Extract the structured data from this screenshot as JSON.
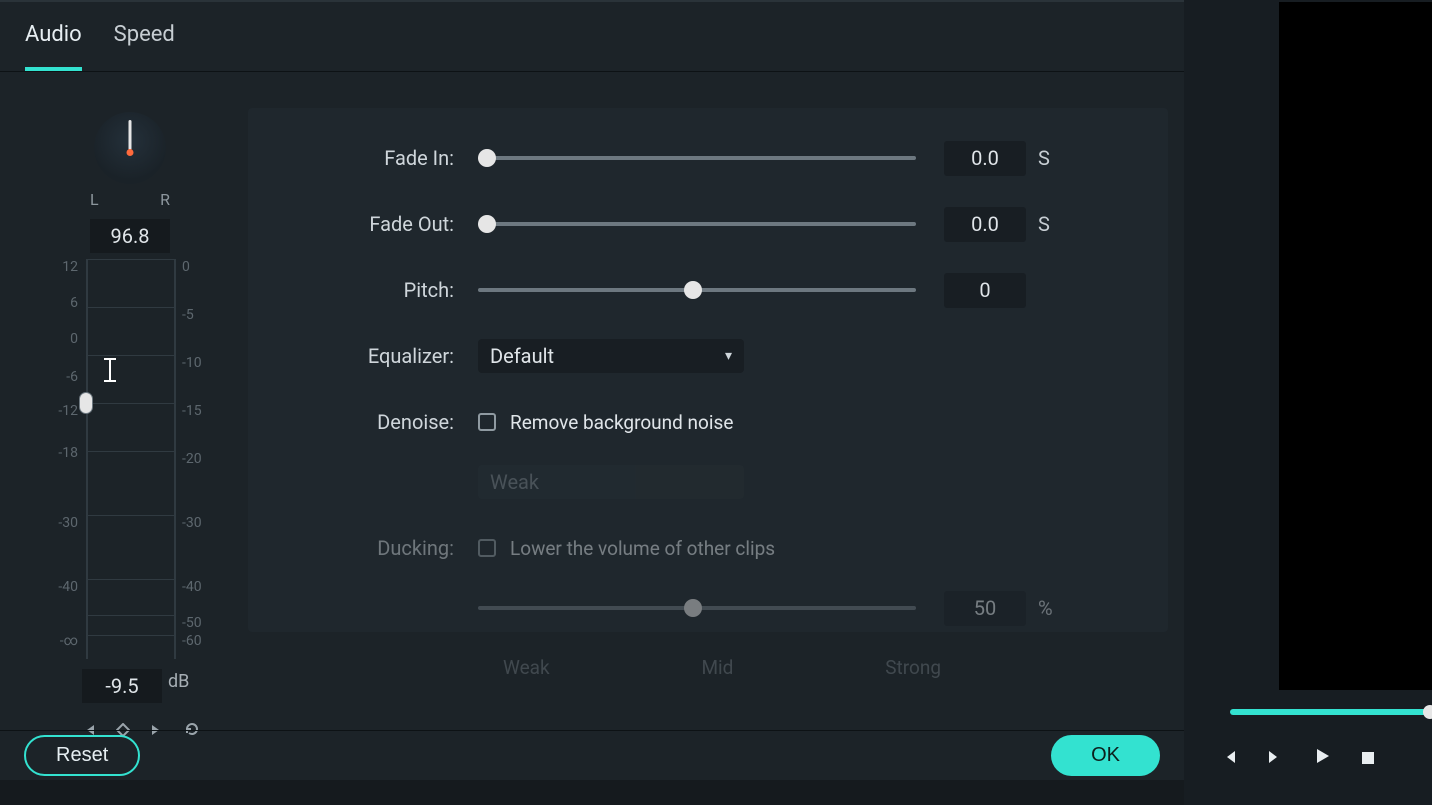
{
  "tabs": {
    "active": "Audio",
    "other": "Speed"
  },
  "pan": {
    "l": "L",
    "r": "R",
    "value": "96.8"
  },
  "db": {
    "left_ticks": [
      "12",
      "6",
      "0",
      "-6",
      "-12",
      "-18",
      "-30",
      "-40",
      "-∞"
    ],
    "right_ticks": [
      "0",
      "-5",
      "-10",
      "-15",
      "-20",
      "-30",
      "-40",
      "-50",
      "-60"
    ],
    "value": "-9.5",
    "unit": "dB"
  },
  "fade_in": {
    "label": "Fade In:",
    "value": "0.0",
    "unit": "S"
  },
  "fade_out": {
    "label": "Fade Out:",
    "value": "0.0",
    "unit": "S"
  },
  "pitch": {
    "label": "Pitch:",
    "value": "0"
  },
  "equalizer": {
    "label": "Equalizer:",
    "value": "Default"
  },
  "denoise": {
    "label": "Denoise:",
    "check_label": "Remove background noise",
    "strength": "Weak"
  },
  "ducking": {
    "label": "Ducking:",
    "check_label": "Lower the volume of other clips",
    "value": "50",
    "unit": "%",
    "marks": {
      "w": "Weak",
      "m": "Mid",
      "s": "Strong"
    }
  },
  "buttons": {
    "reset": "Reset",
    "ok": "OK"
  }
}
